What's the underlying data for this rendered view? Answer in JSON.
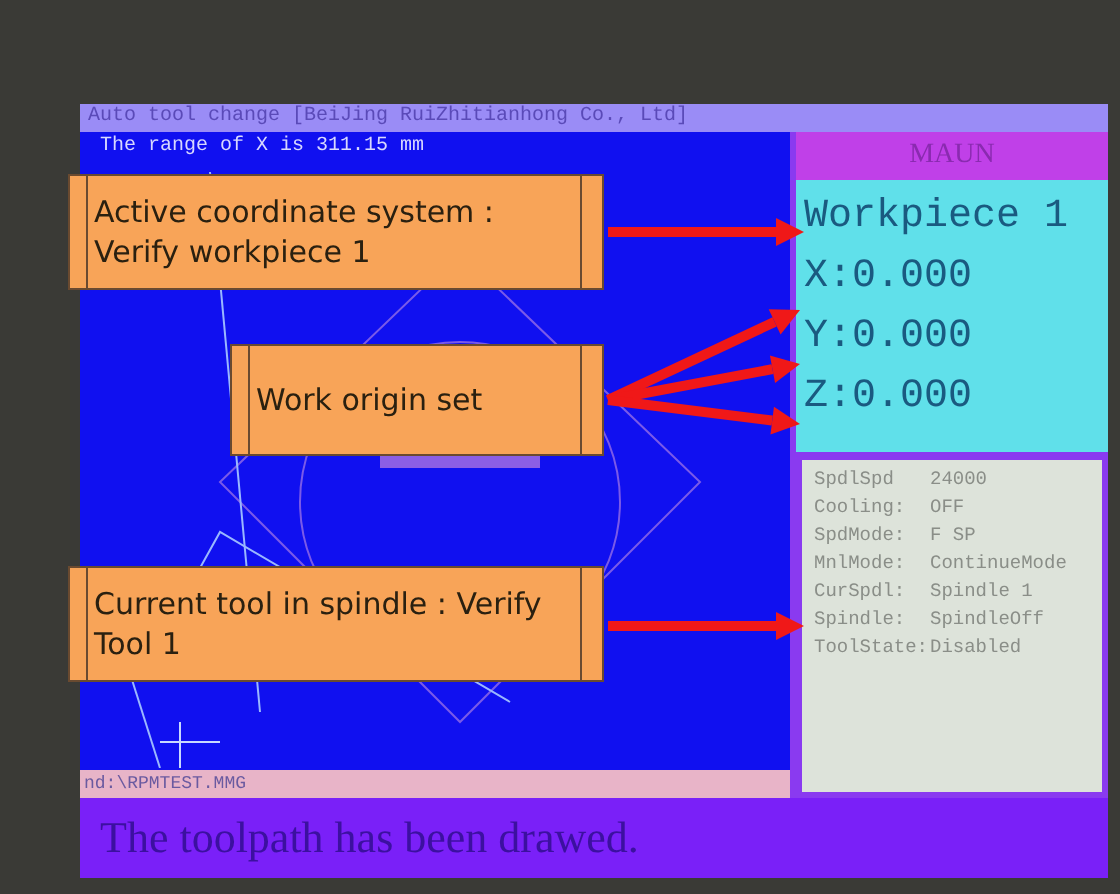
{
  "window": {
    "title": "Auto tool change [BeiJing RuiZhitianhong Co., Ltd]"
  },
  "viewport": {
    "message": "The range of X is 311.15 mm"
  },
  "side_panel": {
    "title": "MAUN",
    "coordinates": {
      "system": "Workpiece 1",
      "axes": [
        "X:0.000",
        "Y:0.000",
        "Z:0.000"
      ]
    },
    "status": [
      {
        "label": "SpdlSpd",
        "value": "24000"
      },
      {
        "label": "Cooling:",
        "value": "OFF"
      },
      {
        "label": "SpdMode:",
        "value": "F SP"
      },
      {
        "label": "MnlMode:",
        "value": "ContinueMode"
      },
      {
        "label": "CurSpdl:",
        "value": "Spindle 1"
      },
      {
        "label": "Spindle:",
        "value": "SpindleOff"
      },
      {
        "label": "ToolState:",
        "value": "Disabled"
      }
    ]
  },
  "file_path": "nd:\\RPMTEST.MMG",
  "status_bar": "The toolpath has been drawed.",
  "callouts": [
    {
      "text": "Active coordinate system : Verify workpiece 1",
      "kind": "wide"
    },
    {
      "text": "Work origin set",
      "kind": "narrow"
    },
    {
      "text": "Current tool in spindle : Verify Tool 1",
      "kind": "wide"
    }
  ]
}
